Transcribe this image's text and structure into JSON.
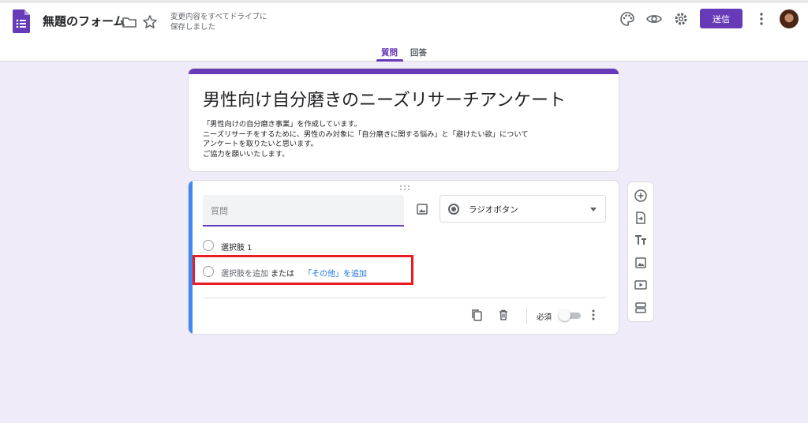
{
  "app": {
    "title": "無題のフォーム",
    "save_status": [
      "変更内容をすべてドライブに",
      "保存しました"
    ],
    "send_label": "送信",
    "accent": "#673ab7"
  },
  "tabs": [
    {
      "label": "質問",
      "active": true
    },
    {
      "label": "回答",
      "active": false
    }
  ],
  "survey": {
    "title": "男性向け自分磨きのニーズリサーチアンケート",
    "description": [
      "「男性向けの自分磨き事業」を作成しています。",
      "ニーズリサーチをするために、男性のみ対象に「自分磨きに関する悩み」と「避けたい欲」について",
      "アンケートを取りたいと思います。",
      "ご協力を願いいたします。"
    ]
  },
  "question": {
    "placeholder": "質問",
    "type_label": "ラジオボタン",
    "options": [
      "選択肢 1"
    ],
    "add_option": "選択肢を追加",
    "or_text": "または",
    "add_other": "「その他」を追加",
    "required_label": "必須",
    "required": false
  },
  "icons": {
    "header": [
      "folder-icon",
      "star-icon",
      "palette-icon",
      "preview-icon",
      "settings-icon",
      "more-vert-icon"
    ],
    "toolbar": [
      "add-question-icon",
      "import-questions-icon",
      "title-text-icon",
      "image-icon",
      "video-icon",
      "section-icon"
    ]
  }
}
